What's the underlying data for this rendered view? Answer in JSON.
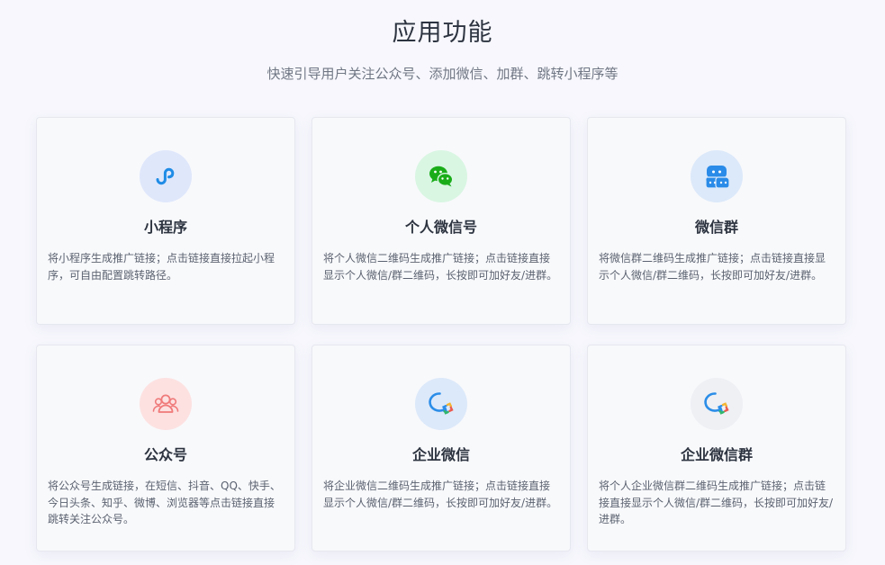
{
  "page": {
    "title": "应用功能",
    "subtitle": "快速引导用户关注公众号、添加微信、加群、跳转小程序等"
  },
  "cards": [
    {
      "title": "小程序",
      "description": "将小程序生成推广链接；点击链接直接拉起小程序，可自由配置跳转路径。",
      "icon": "mini-program-icon",
      "icon_bg": "#dfe7fb",
      "icon_color": "#1f8ce6"
    },
    {
      "title": "个人微信号",
      "description": "将个人微信二维码生成推广链接；点击链接直接显示个人微信/群二维码，长按即可加好友/进群。",
      "icon": "wechat-icon",
      "icon_bg": "#d9f6e3",
      "icon_color": "#1aad19"
    },
    {
      "title": "微信群",
      "description": "将微信群二维码生成推广链接；点击链接直接显示个人微信/群二维码，长按即可加好友/进群。",
      "icon": "group-chat-icon",
      "icon_bg": "#dce9fa",
      "icon_color": "#2a8be8"
    },
    {
      "title": "公众号",
      "description": "将公众号生成链接，在短信、抖音、QQ、快手、今日头条、知乎、微博、浏览器等点击链接直接跳转关注公众号。",
      "icon": "official-account-icon",
      "icon_bg": "#fde1e1",
      "icon_color": "#f07a7a"
    },
    {
      "title": "企业微信",
      "description": "将企业微信二维码生成推广链接；点击链接直接显示个人微信/群二维码，长按即可加好友/进群。",
      "icon": "wecom-icon",
      "icon_bg": "#dce9fa",
      "icon_color": "#2b8de8"
    },
    {
      "title": "企业微信群",
      "description": "将个人企业微信群二维码生成推广链接；点击链接直接显示个人微信/群二维码，长按即可加好友/进群。",
      "icon": "wecom-group-icon",
      "icon_bg": "#eef0f4",
      "icon_color": "#2b8de8"
    }
  ]
}
